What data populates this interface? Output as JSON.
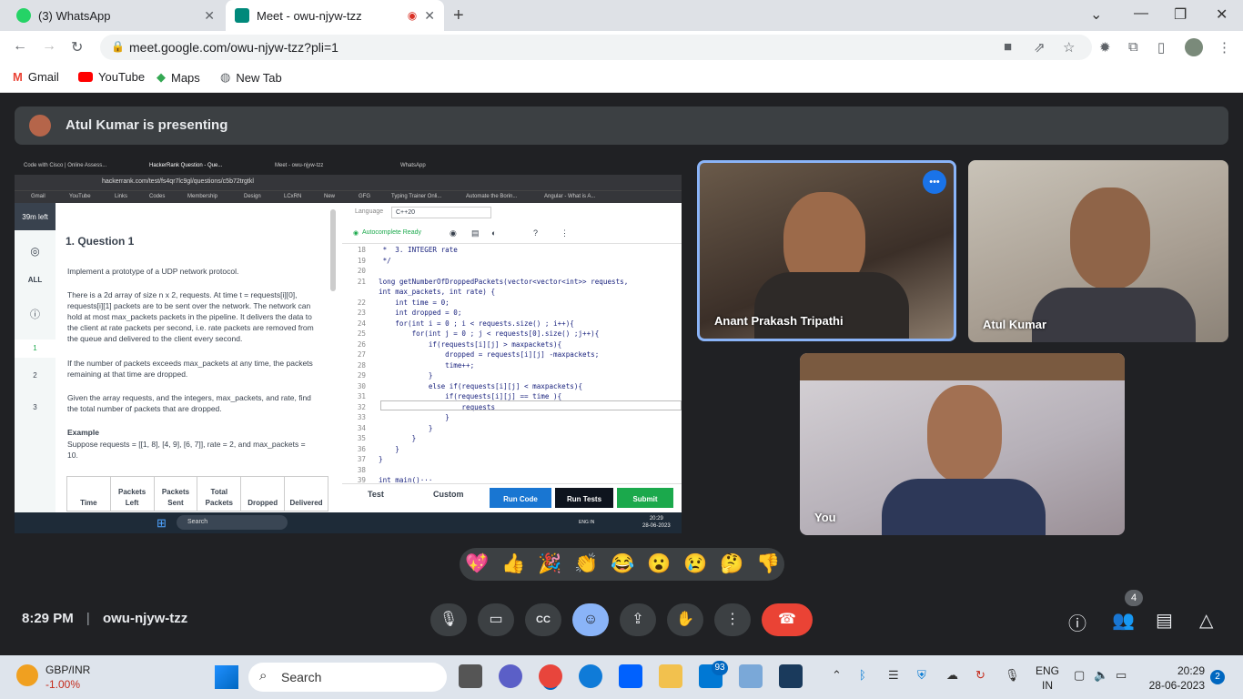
{
  "browser": {
    "tabs": [
      {
        "label": "(3) WhatsApp",
        "favicon_color": "#25d366"
      },
      {
        "label": "Meet - owu-njyw-tzz",
        "favicon_color": "#00897b"
      }
    ],
    "url": "meet.google.com/owu-njyw-tzz?pli=1",
    "bookmarks": [
      "Gmail",
      "YouTube",
      "Maps",
      "New Tab"
    ]
  },
  "meet": {
    "presenting": "Atul Kumar is presenting",
    "participants": [
      "Anant Prakash Tripathi",
      "Atul Kumar",
      "You"
    ],
    "time": "8:29 PM",
    "meeting_code": "owu-njyw-tzz",
    "people_count": "4",
    "reactions": [
      "💖",
      "👍",
      "🎉",
      "👏",
      "😂",
      "😮",
      "😢",
      "🤔",
      "👎"
    ]
  },
  "shared": {
    "tabs": [
      "Code with Cisco | Online Assess...",
      "HackerRank Question - Que...",
      "Meet - owu-njyw-tzz",
      "WhatsApp"
    ],
    "url": "hackerrank.com/test/fs4qr7lc9gl/questions/c5b72trgtkl",
    "bookmarks": [
      "Gmail",
      "YouTube",
      "Links",
      "Codes",
      "Membership",
      "Design",
      "LCxRN",
      "New",
      "GFG",
      "Typing Trainer Onli...",
      "Automate the Borin...",
      "Angular - What is A..."
    ],
    "time_left": "39m left",
    "nav": [
      "ALL",
      "1",
      "2",
      "3"
    ],
    "question_title": "1. Question 1",
    "para1": "Implement a prototype of a UDP network protocol.",
    "para2": "There is a 2d array of size n x 2, requests. At time t = requests[i][0], requests[i][1] packets are to be sent over the network. The network can hold at most max_packets packets in the pipeline. It delivers the data to the client at rate packets per second, i.e. rate packets are removed from the queue and delivered to the client every second.",
    "para3": "If the number of packets exceeds max_packets at any time, the packets remaining at that time are dropped.",
    "para4": "Given the array requests, and the integers, max_packets, and rate, find the total number of packets that are dropped.",
    "example_title": "Example",
    "example_text": "Suppose requests = [[1, 8], [4, 9], [6, 7]], rate = 2, and max_packets = 10.",
    "table_headers": [
      "Time",
      "Packets Left",
      "Packets Sent",
      "Total Packets",
      "Dropped",
      "Delivered"
    ],
    "language_label": "Language",
    "language": "C++20",
    "autocomplete": "Autocomplete Ready",
    "code_lines": [
      {
        "n": "18",
        "t": " *  3. INTEGER rate"
      },
      {
        "n": "19",
        "t": " */"
      },
      {
        "n": "20",
        "t": ""
      },
      {
        "n": "21",
        "t": "long getNumberOfDroppedPackets(vector<vector<int>> requests,"
      },
      {
        "n": "",
        "t": "int max_packets, int rate) {"
      },
      {
        "n": "22",
        "t": "    int time = 0;"
      },
      {
        "n": "23",
        "t": "    int dropped = 0;"
      },
      {
        "n": "24",
        "t": "    for(int i = 0 ; i < requests.size() ; i++){"
      },
      {
        "n": "25",
        "t": "        for(int j = 0 ; j < requests[0].size() ;j++){"
      },
      {
        "n": "26",
        "t": "            if(requests[i][j] > maxpackets){"
      },
      {
        "n": "27",
        "t": "                dropped = requests[i][j] -maxpackets;"
      },
      {
        "n": "28",
        "t": "                time++;"
      },
      {
        "n": "29",
        "t": "            }"
      },
      {
        "n": "30",
        "t": "            else if(requests[i][j] < maxpackets){"
      },
      {
        "n": "31",
        "t": "                if(requests[i][j] == time ){"
      },
      {
        "n": "32",
        "t": "                    requests"
      },
      {
        "n": "33",
        "t": "                }"
      },
      {
        "n": "34",
        "t": "            }"
      },
      {
        "n": "35",
        "t": "        }"
      },
      {
        "n": "36",
        "t": "    }"
      },
      {
        "n": "37",
        "t": "}"
      },
      {
        "n": "38",
        "t": ""
      },
      {
        "n": "39",
        "t": "int main()···"
      }
    ],
    "bottom_tabs": [
      "Test",
      "Custom"
    ],
    "run_code": "Run Code",
    "run_tests": "Run Tests",
    "submit": "Submit",
    "taskbar_search": "Search",
    "taskbar_lang": "ENG IN",
    "taskbar_time": "20:29",
    "taskbar_date": "28-06-2023"
  },
  "taskbar": {
    "widget_title": "GBP/INR",
    "widget_value": "-1.00%",
    "search": "Search",
    "mail_badge": "93",
    "lang1": "ENG",
    "lang2": "IN",
    "time": "20:29",
    "date": "28-06-2023",
    "notif": "2"
  }
}
